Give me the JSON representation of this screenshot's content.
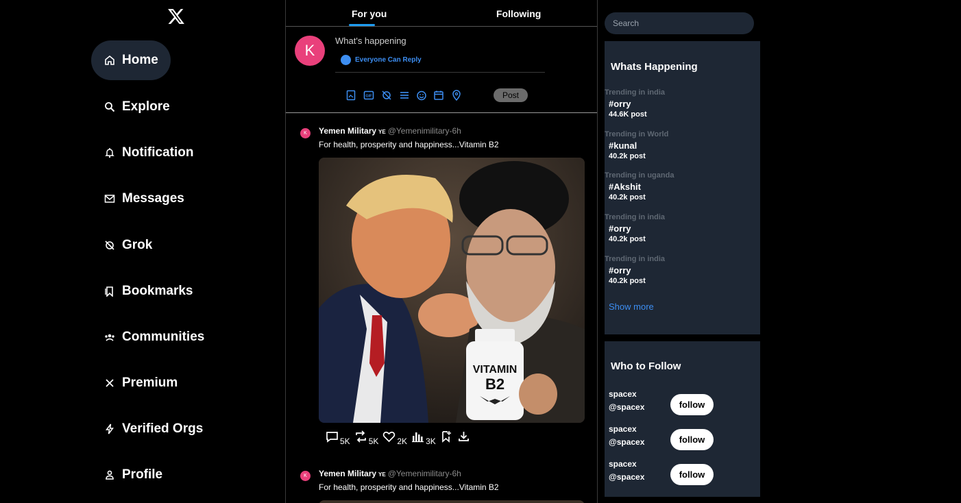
{
  "nav": {
    "items": [
      {
        "label": "Home",
        "icon": "home-icon"
      },
      {
        "label": "Explore",
        "icon": "search-icon"
      },
      {
        "label": "Notification",
        "icon": "bell-icon"
      },
      {
        "label": "Messages",
        "icon": "mail-icon"
      },
      {
        "label": "Grok",
        "icon": "grok-icon"
      },
      {
        "label": "Bookmarks",
        "icon": "bookmark-icon"
      },
      {
        "label": "Communities",
        "icon": "communities-icon"
      },
      {
        "label": "Premium",
        "icon": "x-premium-icon"
      },
      {
        "label": "Verified Orgs",
        "icon": "lightning-icon"
      },
      {
        "label": "Profile",
        "icon": "user-icon"
      }
    ]
  },
  "tabs": {
    "for_you": "For you",
    "following": "Following"
  },
  "composer": {
    "avatar_letter": "K",
    "placeholder": "What's happening",
    "reply_setting": "Everyone Can Reply",
    "post_label": "Post"
  },
  "tweets": [
    {
      "avatar_letter": "K",
      "name": "Yemen Military",
      "flag": "YE",
      "handle": "@Yemenimilitary-6h",
      "text": "For health, prosperity and happiness...Vitamin B2",
      "media_text": "VITAMIN B2",
      "replies": "5K",
      "reposts": "5K",
      "likes": "2K",
      "views": "3K"
    },
    {
      "avatar_letter": "K",
      "name": "Yemen Military",
      "flag": "YE",
      "handle": "@Yemenimilitary-6h",
      "text": "For health, prosperity and happiness...Vitamin B2"
    }
  ],
  "search": {
    "placeholder": "Search"
  },
  "trending": {
    "title": "Whats Happening",
    "items": [
      {
        "category": "Trending in india",
        "tag": "#orry",
        "count": "44.6K post"
      },
      {
        "category": "Trending in World",
        "tag": "#kunal",
        "count": "40.2k post"
      },
      {
        "category": "Trending in uganda",
        "tag": "#Akshit",
        "count": "40.2k post"
      },
      {
        "category": "Trending in india",
        "tag": "#orry",
        "count": "40.2k post"
      },
      {
        "category": "Trending in india",
        "tag": "#orry",
        "count": "40.2k post"
      }
    ],
    "show_more": "Show more"
  },
  "who_to_follow": {
    "title": "Who to Follow",
    "items": [
      {
        "name": "spacex",
        "handle": "@spacex",
        "button": "follow"
      },
      {
        "name": "spacex",
        "handle": "@spacex",
        "button": "follow"
      },
      {
        "name": "spacex",
        "handle": "@spacex",
        "button": "follow"
      }
    ]
  },
  "colors": {
    "accent": "#1d9bf0",
    "link": "#3d8ef2",
    "panel": "#1e2734",
    "avatar": "#e9407b"
  }
}
